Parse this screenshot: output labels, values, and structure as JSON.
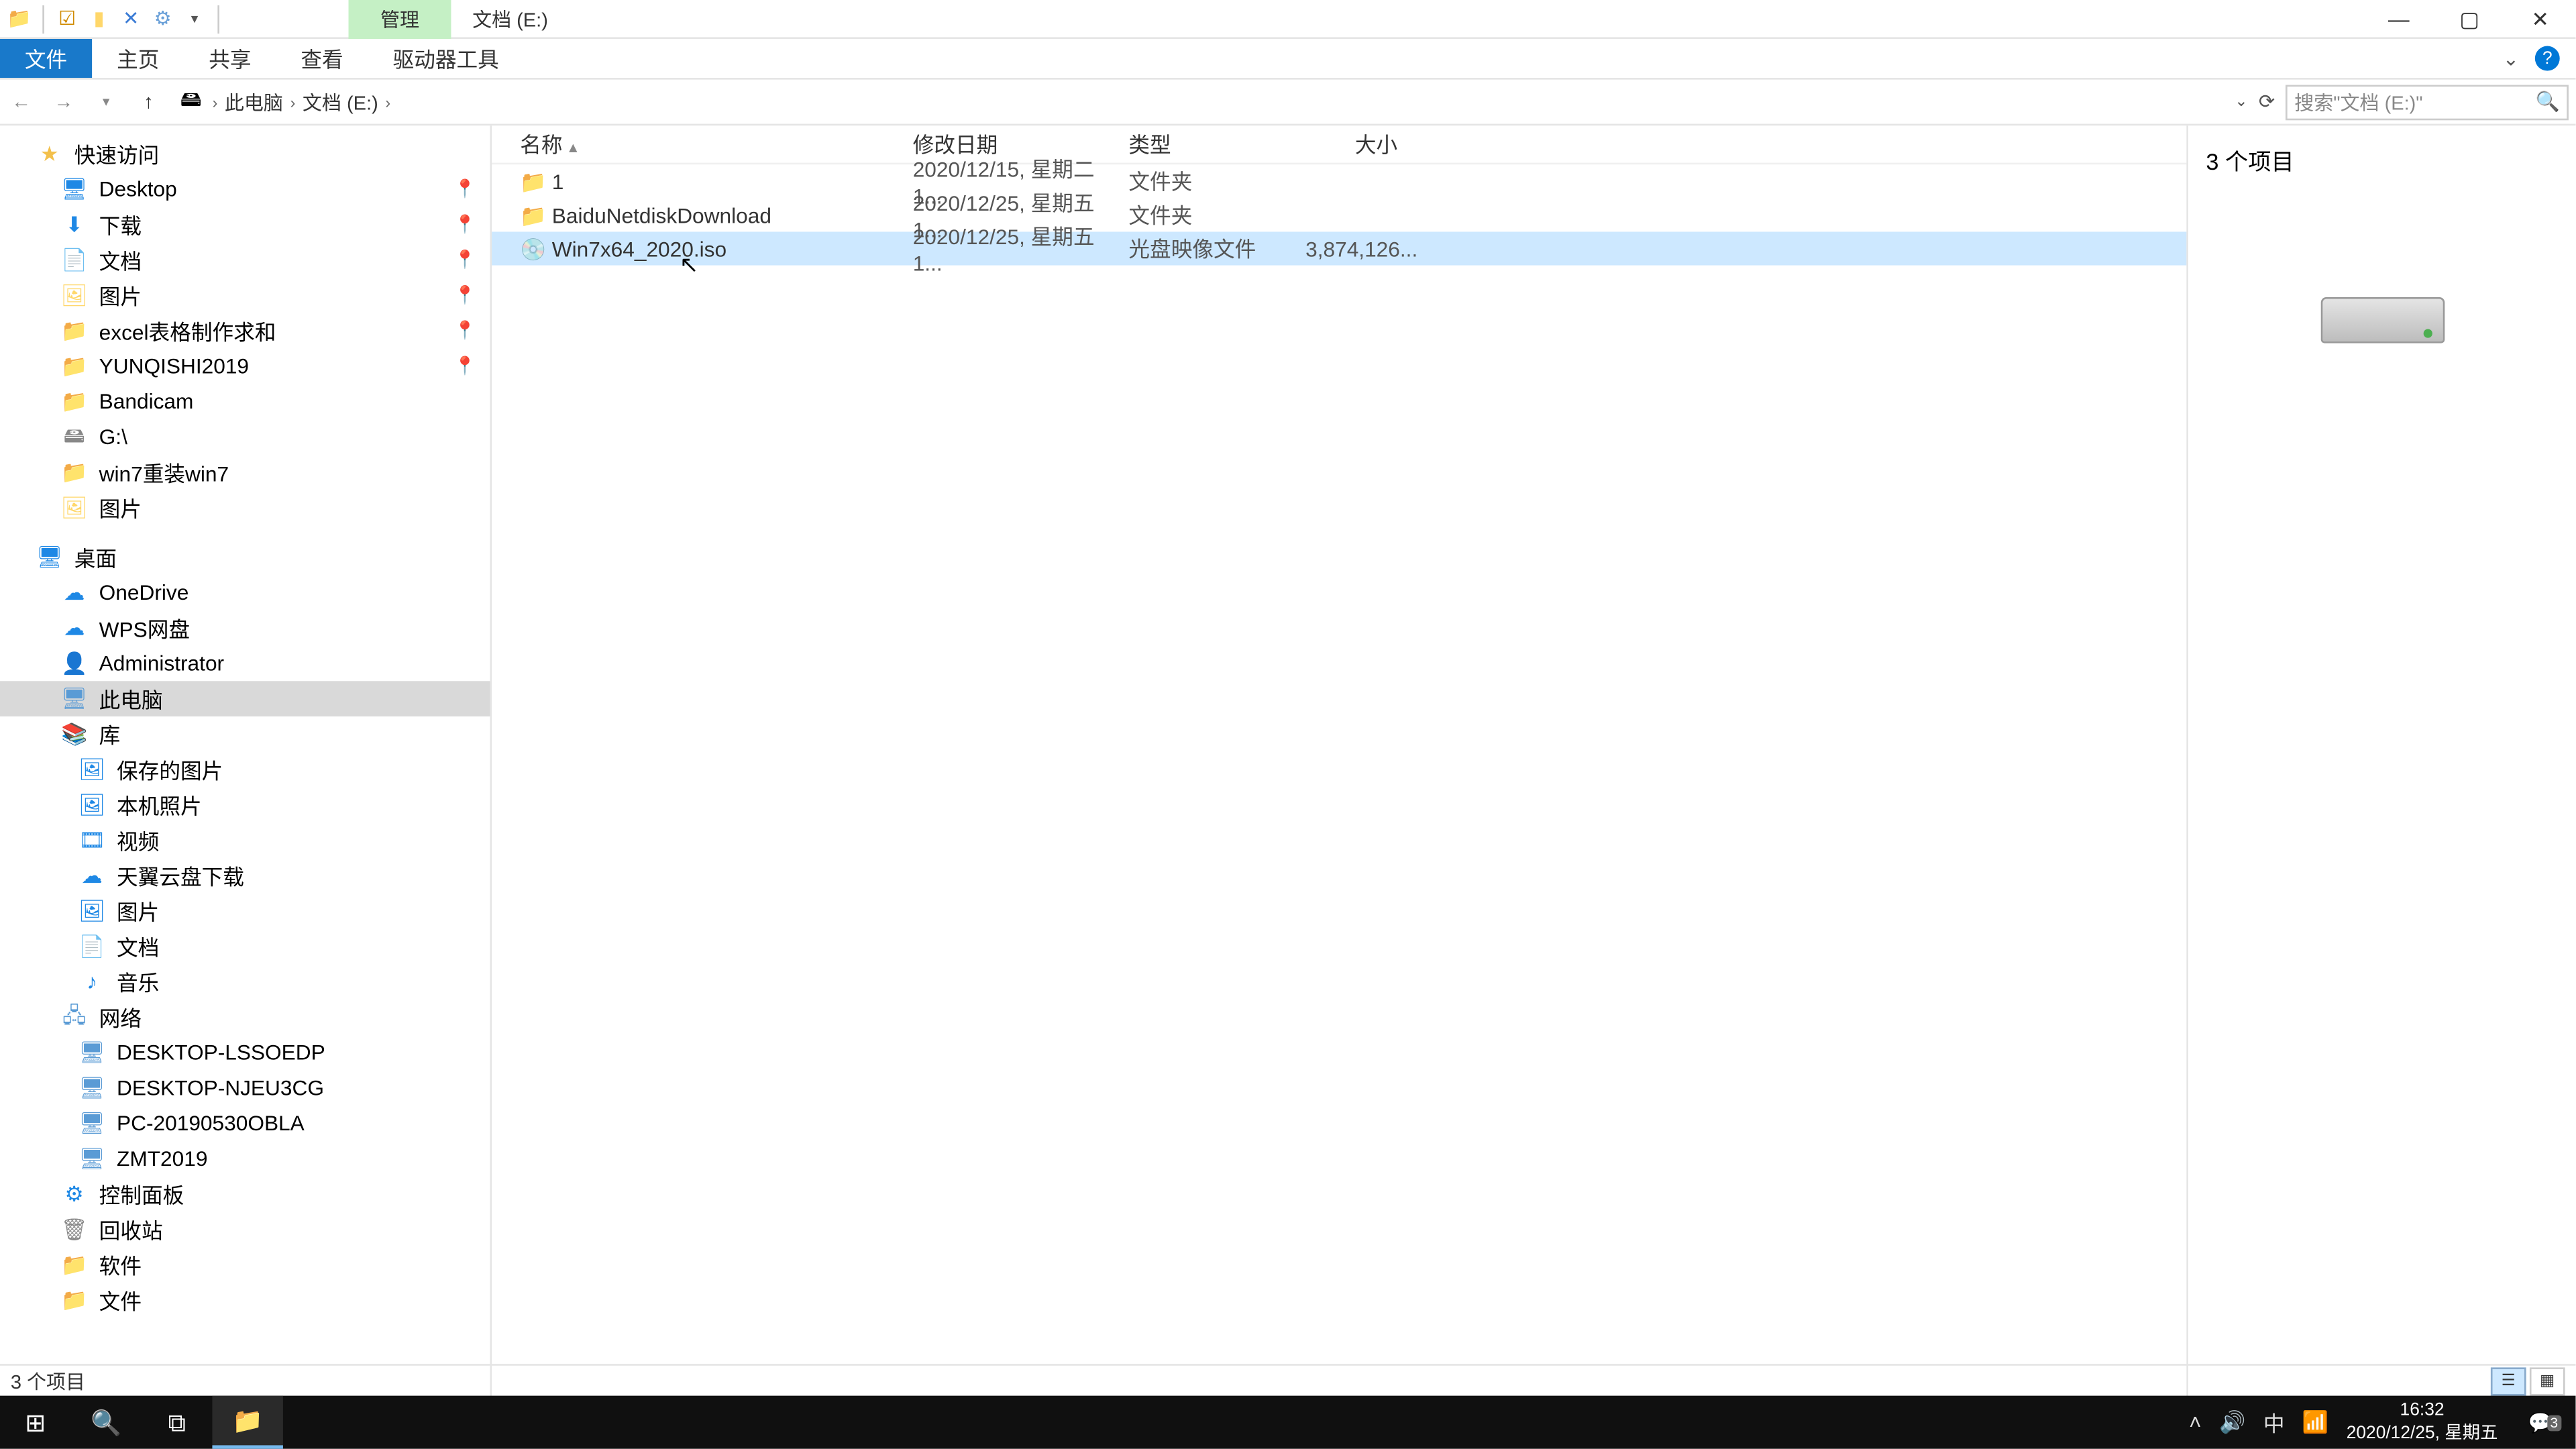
{
  "title": {
    "context_tab": "管理",
    "location": "文档 (E:)"
  },
  "ribbon": {
    "file": "文件",
    "home": "主页",
    "share": "共享",
    "view": "查看",
    "drive_tools": "驱动器工具"
  },
  "breadcrumb": {
    "pc": "此电脑",
    "loc": "文档 (E:)"
  },
  "search": {
    "placeholder": "搜索\"文档 (E:)\""
  },
  "nav": {
    "quick": "快速访问",
    "items_quick": [
      "Desktop",
      "下载",
      "文档",
      "图片",
      "excel表格制作求和",
      "YUNQISHI2019",
      "Bandicam",
      "G:\\",
      "win7重装win7",
      "图片"
    ],
    "desktop": "桌面",
    "desktop_items": [
      "OneDrive",
      "WPS网盘",
      "Administrator",
      "此电脑",
      "库"
    ],
    "lib_items": [
      "保存的图片",
      "本机照片",
      "视频",
      "天翼云盘下载",
      "图片",
      "文档",
      "音乐"
    ],
    "network": "网络",
    "net_items": [
      "DESKTOP-LSSOEDP",
      "DESKTOP-NJEU3CG",
      "PC-20190530OBLA",
      "ZMT2019"
    ],
    "cpanel": "控制面板",
    "recycle": "回收站",
    "soft": "软件",
    "docs": "文件"
  },
  "columns": {
    "name": "名称",
    "date": "修改日期",
    "type": "类型",
    "size": "大小"
  },
  "files": [
    {
      "name": "1",
      "date": "2020/12/15, 星期二 1...",
      "type": "文件夹",
      "size": "",
      "icon": "folder"
    },
    {
      "name": "BaiduNetdiskDownload",
      "date": "2020/12/25, 星期五 1...",
      "type": "文件夹",
      "size": "",
      "icon": "folder"
    },
    {
      "name": "Win7x64_2020.iso",
      "date": "2020/12/25, 星期五 1...",
      "type": "光盘映像文件",
      "size": "3,874,126...",
      "icon": "iso",
      "selected": true
    }
  ],
  "preview": {
    "count": "3 个项目"
  },
  "status": {
    "text": "3 个项目"
  },
  "tray": {
    "ime": "中",
    "time": "16:32",
    "date": "2020/12/25, 星期五",
    "notif_count": "3"
  }
}
